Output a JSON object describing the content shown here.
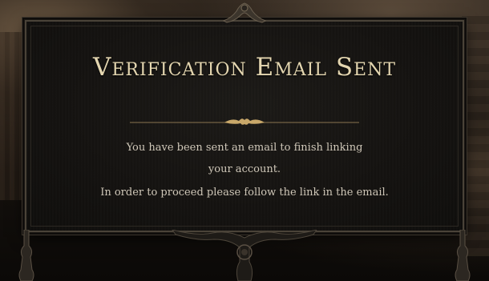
{
  "dialog": {
    "title": "Verification Email Sent",
    "message": "You have been sent an email to finish linking your account.",
    "instruction": "In order to proceed please follow the link in the email."
  },
  "colors": {
    "title": "#e4d6b0",
    "body_text": "#cfc7b8",
    "panel_bg": "#141210",
    "frame_border": "#4a4338",
    "ornament_gold": "#c9a86a"
  },
  "icons": {
    "top_crest": "ornate-crest-icon",
    "divider": "gold-flourish-icon",
    "bottom": "gothic-ornament-icon"
  }
}
